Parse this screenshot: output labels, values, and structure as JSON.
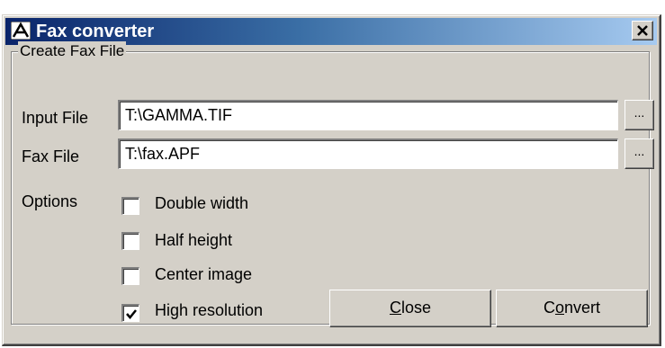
{
  "window": {
    "title": "Fax converter",
    "close_glyph": "×"
  },
  "group": {
    "legend": "Create Fax File"
  },
  "fields": {
    "input_file": {
      "label": "Input File",
      "value": "T:\\GAMMA.TIF",
      "browse": "..."
    },
    "fax_file": {
      "label": "Fax File",
      "value": "T:\\fax.APF",
      "browse": "..."
    }
  },
  "options": {
    "label": "Options",
    "items": [
      {
        "label": "Double width",
        "checked": false
      },
      {
        "label": "Half height",
        "checked": false
      },
      {
        "label": "Center image",
        "checked": false
      },
      {
        "label": "High resolution",
        "checked": true
      }
    ]
  },
  "buttons": {
    "close": {
      "mnemonic": "C",
      "rest": "lose"
    },
    "convert": {
      "pre": "C",
      "mnemonic": "o",
      "rest": "nvert"
    }
  },
  "colors": {
    "title_start": "#0a246a",
    "title_end": "#a6caf0",
    "face": "#d4d0c8"
  }
}
